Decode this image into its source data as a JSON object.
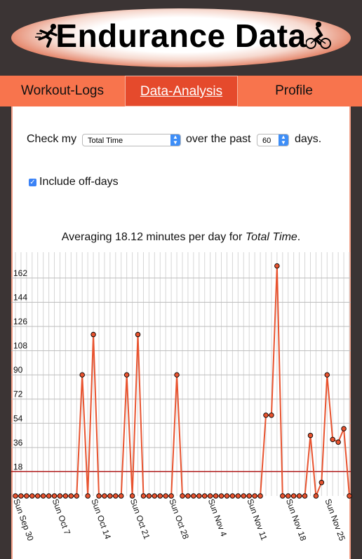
{
  "header": {
    "title": "Endurance Data",
    "logo_left_icon": "runner-icon",
    "logo_right_icon": "cyclist-icon"
  },
  "nav": {
    "tabs": [
      {
        "label": "Workout-Logs",
        "active": false
      },
      {
        "label": "Data-Analysis",
        "active": true
      },
      {
        "label": "Profile",
        "active": false
      }
    ]
  },
  "controls": {
    "check_my_label": "Check my",
    "metric_selected": "Total Time",
    "over_the_past_label": "over the past",
    "days_selected": "60",
    "days_label": "days.",
    "include_offdays_label": "Include off-days",
    "include_offdays_checked": true
  },
  "summary": {
    "prefix": "Averaging 18.12 minutes per day for ",
    "metric": "Total Time",
    "suffix": "."
  },
  "colors": {
    "line": "#e8532f",
    "marker_fill": "#e8532f",
    "average_line": "#b01e1e",
    "grid": "#d6d6d6"
  },
  "chart_data": {
    "type": "line",
    "ylim": [
      0,
      176
    ],
    "yticks": [
      18,
      36,
      54,
      72,
      90,
      108,
      126,
      144,
      162
    ],
    "grid": true,
    "average": 18.12,
    "xtick_labels": [
      {
        "label": "Sun Sep 30",
        "day": 0
      },
      {
        "label": "Sun Oct 7",
        "day": 7
      },
      {
        "label": "Sun Oct 14",
        "day": 14
      },
      {
        "label": "Sun Oct 21",
        "day": 21
      },
      {
        "label": "Sun Oct 28",
        "day": 28
      },
      {
        "label": "Sun Nov 4",
        "day": 35
      },
      {
        "label": "Sun Nov 11",
        "day": 42
      },
      {
        "label": "Sun Nov 18",
        "day": 49
      },
      {
        "label": "Sun Nov 25",
        "day": 56
      }
    ],
    "values": [
      0,
      0,
      0,
      0,
      0,
      0,
      0,
      0,
      0,
      0,
      0,
      0,
      90,
      0,
      120,
      0,
      0,
      0,
      0,
      0,
      90,
      0,
      120,
      0,
      0,
      0,
      0,
      0,
      0,
      90,
      0,
      0,
      0,
      0,
      0,
      0,
      0,
      0,
      0,
      0,
      0,
      0,
      0,
      0,
      0,
      60,
      60,
      171,
      0,
      0,
      0,
      0,
      0,
      45,
      0,
      10,
      90,
      42,
      40,
      50,
      0
    ]
  }
}
